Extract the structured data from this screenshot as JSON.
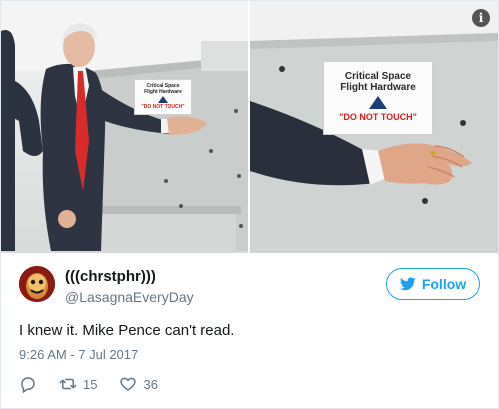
{
  "media": {
    "left_sign": {
      "line1": "Critical Space",
      "line2": "Flight Hardware",
      "warning": "\"DO NOT TOUCH\""
    },
    "right_sign": {
      "line1": "Critical Space",
      "line2": "Flight Hardware",
      "warning": "\"DO NOT TOUCH\""
    },
    "info_icon": "info-icon"
  },
  "tweet": {
    "display_name": "(((chrstphr)))",
    "handle": "@LasagnaEveryDay",
    "follow_label": "Follow",
    "text": "I knew it. Mike Pence can't read.",
    "timestamp": "9:26 AM - 7 Jul 2017",
    "retweet_count": "15",
    "like_count": "36"
  },
  "colors": {
    "accent": "#1da1f2",
    "muted": "#657786",
    "text": "#14171a",
    "warning_red": "#d42020"
  },
  "icons": {
    "reply": "reply-icon",
    "retweet": "retweet-icon",
    "like": "heart-icon",
    "bird": "twitter-bird-icon"
  }
}
